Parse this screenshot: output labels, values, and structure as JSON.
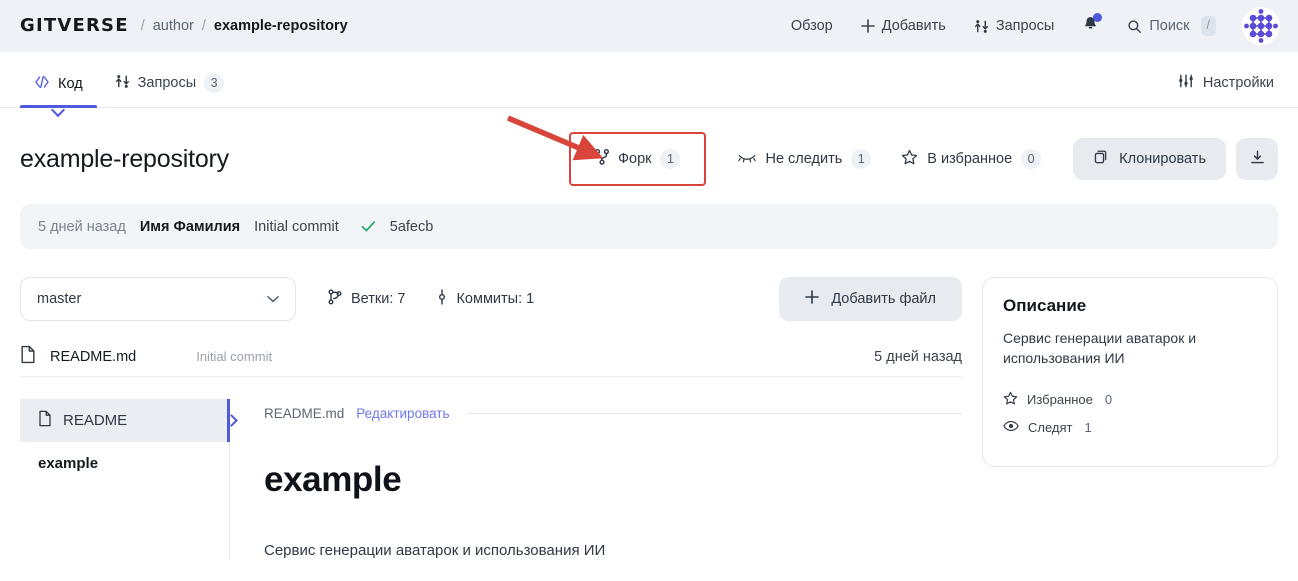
{
  "header": {
    "logo_text": "GITVERSE",
    "breadcrumb": {
      "separator": "/",
      "owner": "author",
      "repo": "example-repository"
    },
    "nav": [
      {
        "label": "Обзор",
        "icon": ""
      },
      {
        "label": "Добавить",
        "icon": "plus-icon"
      },
      {
        "label": "Запросы",
        "icon": "pull-request-icon"
      }
    ],
    "notifications": {
      "icon": "bell-icon",
      "has_unread": true,
      "dot_color": "#4f59dd"
    },
    "search": {
      "label": "Поиск",
      "icon": "search-icon",
      "shortcut": "/"
    },
    "avatar": {
      "icon": "user-avatar",
      "color": "#5b4bd6"
    },
    "background": "#eef1f5"
  },
  "tabs": [
    {
      "label": "Код",
      "icon": "code-icon",
      "active": true,
      "count": ""
    },
    {
      "label": "Запросы",
      "icon": "pull-request-icon",
      "active": false,
      "count": "3"
    }
  ],
  "settings": {
    "label": "Настройки",
    "icon": "sliders-icon"
  },
  "repo": {
    "title": "example-repository",
    "actions": [
      {
        "name": "fork",
        "label": "Форк",
        "icon": "fork-icon",
        "count": "1",
        "highlighted": true
      },
      {
        "name": "unwatch",
        "label": "Не следить",
        "icon": "eye-slash-icon",
        "count": "1",
        "highlighted": false
      },
      {
        "name": "favorite",
        "label": "В избранное",
        "icon": "star-icon",
        "count": "0",
        "highlighted": false
      }
    ],
    "clone_button": {
      "label": "Клонировать",
      "icon": "copy-icon"
    },
    "download_button": {
      "icon": "download-icon"
    }
  },
  "commit_bar": {
    "when": "5 дней назад",
    "author": "Имя Фамилия",
    "message": "Initial commit",
    "check_icon": "check-icon",
    "check_color": "#1fa463",
    "hash": "5afecb"
  },
  "branch": {
    "selected": "master",
    "chevron": "chevron-down-icon"
  },
  "stats": [
    {
      "label": "Ветки: 7",
      "icon": "branch-icon"
    },
    {
      "label": "Коммиты: 1",
      "icon": "commit-icon"
    }
  ],
  "add_file_button": {
    "label": "Добавить файл",
    "icon": "plus-icon"
  },
  "files": {
    "columns": [
      "name",
      "message",
      "when"
    ],
    "rows": [
      {
        "icon": "file-icon",
        "name": "README.md",
        "message": "Initial commit",
        "when": "5 дней назад"
      }
    ]
  },
  "readme_nav": {
    "items": [
      {
        "label": "README",
        "icon": "file-icon",
        "active": true
      },
      {
        "label": "example",
        "icon": "",
        "active": false
      }
    ]
  },
  "readme": {
    "file_name": "README.md",
    "edit_label": "Редактировать",
    "heading": "example",
    "paragraph": "Сервис генерации аватарок и использования ИИ"
  },
  "description_panel": {
    "title": "Описание",
    "text": "Сервис генерации аватарок и использования ИИ",
    "stats": [
      {
        "label": "Избранное",
        "icon": "star-icon",
        "value": "0"
      },
      {
        "label": "Следят",
        "icon": "eye-icon",
        "value": "1"
      }
    ]
  },
  "annotation": {
    "type": "arrow",
    "color": "#d9453a",
    "points_to": "fork-button"
  }
}
